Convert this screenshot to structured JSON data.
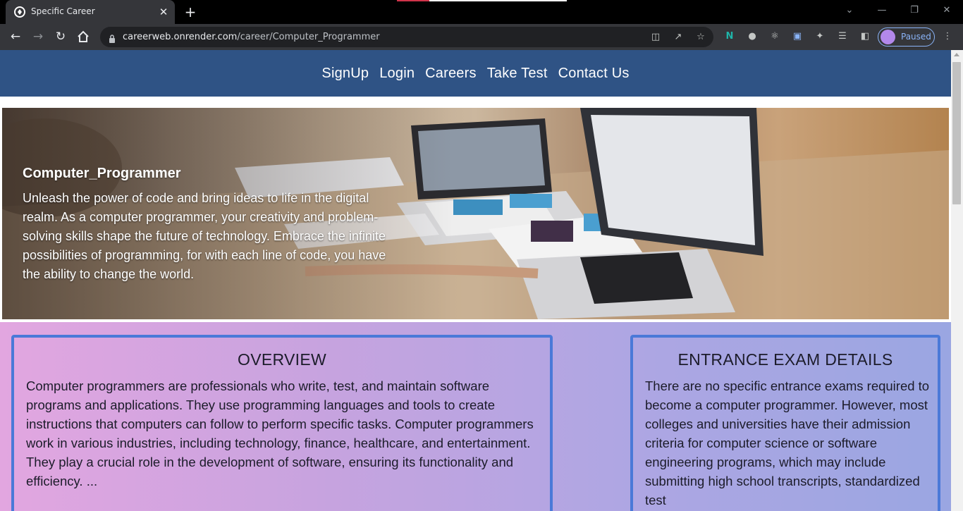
{
  "browser": {
    "tab_title": "Specific Career",
    "tab_close": "✕",
    "new_tab": "+",
    "url_host": "careerweb.onrender.com",
    "url_path": "/career/Computer_Programmer",
    "profile_label": "Paused",
    "window_controls": [
      "⌄",
      "—",
      "❐",
      "✕"
    ],
    "colors": {
      "tabbar": "#000000",
      "toolbar": "#35363a",
      "omnibox": "#202124",
      "profile_accent": "#8ab4f8"
    }
  },
  "site": {
    "nav": [
      "SignUp",
      "Login",
      "Careers",
      "Take Test",
      "Contact Us"
    ],
    "colors": {
      "nav_bg": "#2f5385",
      "card_border": "#4a79d8"
    }
  },
  "hero": {
    "title": "Computer_Programmer",
    "description": "Unleash the power of code and bring ideas to life in the digital realm. As a computer programmer, your creativity and problem-solving skills shape the future of technology. Embrace the infinite possibilities of programming, for with each line of code, you have the ability to change the world."
  },
  "overview": {
    "title": "OVERVIEW",
    "body": "Computer programmers are professionals who write, test, and maintain software programs and applications. They use programming languages and tools to create instructions that computers can follow to perform specific tasks. Computer programmers work in various industries, including technology, finance, healthcare, and entertainment. They play a crucial role in the development of software, ensuring its functionality and efficiency. ..."
  },
  "entrance_exam": {
    "title": "ENTRANCE EXAM DETAILS",
    "body": "There are no specific entrance exams required to become a computer programmer. However, most colleges and universities have their admission criteria for computer science or software engineering programs, which may include submitting high school transcripts, standardized test"
  }
}
